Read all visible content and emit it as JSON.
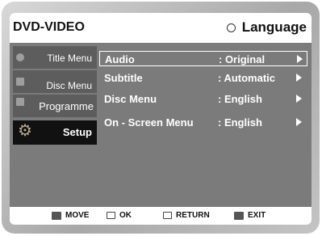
{
  "header": {
    "title": "DVD-VIDEO",
    "section": "Language"
  },
  "sidebar": {
    "items": [
      {
        "label": "Title Menu"
      },
      {
        "label": "Disc Menu"
      },
      {
        "label": "Programme"
      },
      {
        "label": "Setup"
      }
    ]
  },
  "menu": {
    "rows": [
      {
        "name": "Audio",
        "value": ": Original"
      },
      {
        "name": "Subtitle",
        "value": ": Automatic"
      },
      {
        "name": "Disc Menu",
        "value": ": English"
      },
      {
        "name": "On - Screen Menu",
        "value": ": English"
      }
    ]
  },
  "footer": {
    "move": "MOVE",
    "ok": "OK",
    "return": "RETURN",
    "exit": "EXIT"
  },
  "colors": {
    "screen": "#7b7b7b",
    "sidebar_item": "#5d5d5d",
    "active_item": "#111111",
    "header": "#ffffff"
  },
  "icons": {
    "language": "circle-icon",
    "setup": "gear-icon",
    "move": "updown-icon",
    "ok": "enter-icon",
    "return": "return-icon",
    "exit": "exit-icon"
  }
}
